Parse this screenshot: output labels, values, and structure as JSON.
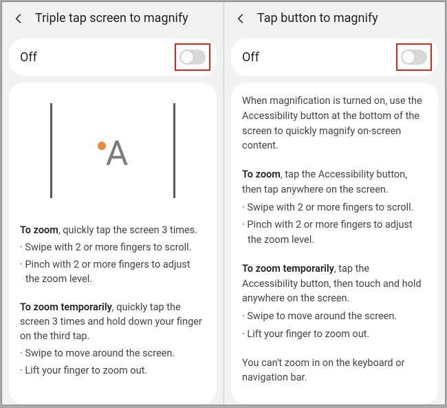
{
  "left": {
    "title": "Triple tap screen to magnify",
    "toggle_label": "Off",
    "sec1_lead_bold": "To zoom",
    "sec1_lead_rest": ", quickly tap the screen 3 times.",
    "sec1_b1": "Swipe with 2 or more fingers to scroll.",
    "sec1_b2": "Pinch with 2 or more fingers to adjust the zoom level.",
    "sec2_lead_bold": "To zoom temporarily",
    "sec2_lead_rest": ", quickly tap the screen 3 times and hold down your finger on the third tap.",
    "sec2_b1": "Swipe to move around the screen.",
    "sec2_b2": "Lift your finger to zoom out."
  },
  "right": {
    "title": "Tap button to magnify",
    "toggle_label": "Off",
    "intro": "When magnification is turned on, use the Accessibility button at the bottom of the screen to quickly magnify on-screen content.",
    "sec1_lead_bold": "To zoom",
    "sec1_lead_rest": ", tap the Accessibility button, then tap anywhere on the screen.",
    "sec1_b1": "Swipe with 2 or more fingers to scroll.",
    "sec1_b2": "Pinch with 2 or more fingers to adjust the zoom level.",
    "sec2_lead_bold": "To zoom temporarily",
    "sec2_lead_rest": ", tap the Accessibility button, then touch and hold anywhere on the screen.",
    "sec2_b1": "Swipe to move around the screen.",
    "sec2_b2": "Lift your finger to zoom out.",
    "note": "You can't zoom in on the keyboard or navigation bar."
  }
}
